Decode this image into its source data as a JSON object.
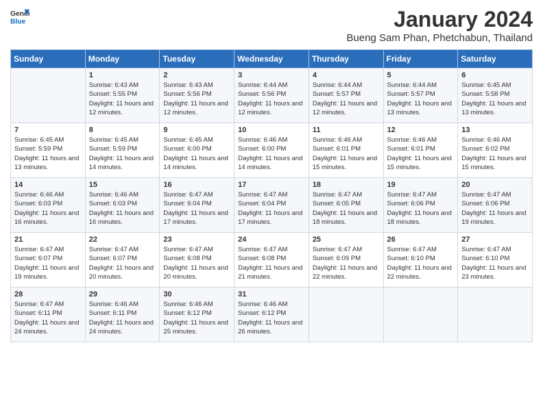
{
  "header": {
    "logo_general": "General",
    "logo_blue": "Blue",
    "month_title": "January 2024",
    "subtitle": "Bueng Sam Phan, Phetchabun, Thailand"
  },
  "days_of_week": [
    "Sunday",
    "Monday",
    "Tuesday",
    "Wednesday",
    "Thursday",
    "Friday",
    "Saturday"
  ],
  "weeks": [
    [
      {
        "day": "",
        "info": ""
      },
      {
        "day": "1",
        "info": "Sunrise: 6:43 AM\nSunset: 5:55 PM\nDaylight: 11 hours and 12 minutes."
      },
      {
        "day": "2",
        "info": "Sunrise: 6:43 AM\nSunset: 5:56 PM\nDaylight: 11 hours and 12 minutes."
      },
      {
        "day": "3",
        "info": "Sunrise: 6:44 AM\nSunset: 5:56 PM\nDaylight: 11 hours and 12 minutes."
      },
      {
        "day": "4",
        "info": "Sunrise: 6:44 AM\nSunset: 5:57 PM\nDaylight: 11 hours and 12 minutes."
      },
      {
        "day": "5",
        "info": "Sunrise: 6:44 AM\nSunset: 5:57 PM\nDaylight: 11 hours and 13 minutes."
      },
      {
        "day": "6",
        "info": "Sunrise: 6:45 AM\nSunset: 5:58 PM\nDaylight: 11 hours and 13 minutes."
      }
    ],
    [
      {
        "day": "7",
        "info": "Sunrise: 6:45 AM\nSunset: 5:59 PM\nDaylight: 11 hours and 13 minutes."
      },
      {
        "day": "8",
        "info": "Sunrise: 6:45 AM\nSunset: 5:59 PM\nDaylight: 11 hours and 14 minutes."
      },
      {
        "day": "9",
        "info": "Sunrise: 6:45 AM\nSunset: 6:00 PM\nDaylight: 11 hours and 14 minutes."
      },
      {
        "day": "10",
        "info": "Sunrise: 6:46 AM\nSunset: 6:00 PM\nDaylight: 11 hours and 14 minutes."
      },
      {
        "day": "11",
        "info": "Sunrise: 6:46 AM\nSunset: 6:01 PM\nDaylight: 11 hours and 15 minutes."
      },
      {
        "day": "12",
        "info": "Sunrise: 6:46 AM\nSunset: 6:01 PM\nDaylight: 11 hours and 15 minutes."
      },
      {
        "day": "13",
        "info": "Sunrise: 6:46 AM\nSunset: 6:02 PM\nDaylight: 11 hours and 15 minutes."
      }
    ],
    [
      {
        "day": "14",
        "info": "Sunrise: 6:46 AM\nSunset: 6:03 PM\nDaylight: 11 hours and 16 minutes."
      },
      {
        "day": "15",
        "info": "Sunrise: 6:46 AM\nSunset: 6:03 PM\nDaylight: 11 hours and 16 minutes."
      },
      {
        "day": "16",
        "info": "Sunrise: 6:47 AM\nSunset: 6:04 PM\nDaylight: 11 hours and 17 minutes."
      },
      {
        "day": "17",
        "info": "Sunrise: 6:47 AM\nSunset: 6:04 PM\nDaylight: 11 hours and 17 minutes."
      },
      {
        "day": "18",
        "info": "Sunrise: 6:47 AM\nSunset: 6:05 PM\nDaylight: 11 hours and 18 minutes."
      },
      {
        "day": "19",
        "info": "Sunrise: 6:47 AM\nSunset: 6:06 PM\nDaylight: 11 hours and 18 minutes."
      },
      {
        "day": "20",
        "info": "Sunrise: 6:47 AM\nSunset: 6:06 PM\nDaylight: 11 hours and 19 minutes."
      }
    ],
    [
      {
        "day": "21",
        "info": "Sunrise: 6:47 AM\nSunset: 6:07 PM\nDaylight: 11 hours and 19 minutes."
      },
      {
        "day": "22",
        "info": "Sunrise: 6:47 AM\nSunset: 6:07 PM\nDaylight: 11 hours and 20 minutes."
      },
      {
        "day": "23",
        "info": "Sunrise: 6:47 AM\nSunset: 6:08 PM\nDaylight: 11 hours and 20 minutes."
      },
      {
        "day": "24",
        "info": "Sunrise: 6:47 AM\nSunset: 6:08 PM\nDaylight: 11 hours and 21 minutes."
      },
      {
        "day": "25",
        "info": "Sunrise: 6:47 AM\nSunset: 6:09 PM\nDaylight: 11 hours and 22 minutes."
      },
      {
        "day": "26",
        "info": "Sunrise: 6:47 AM\nSunset: 6:10 PM\nDaylight: 11 hours and 22 minutes."
      },
      {
        "day": "27",
        "info": "Sunrise: 6:47 AM\nSunset: 6:10 PM\nDaylight: 11 hours and 23 minutes."
      }
    ],
    [
      {
        "day": "28",
        "info": "Sunrise: 6:47 AM\nSunset: 6:11 PM\nDaylight: 11 hours and 24 minutes."
      },
      {
        "day": "29",
        "info": "Sunrise: 6:46 AM\nSunset: 6:11 PM\nDaylight: 11 hours and 24 minutes."
      },
      {
        "day": "30",
        "info": "Sunrise: 6:46 AM\nSunset: 6:12 PM\nDaylight: 11 hours and 25 minutes."
      },
      {
        "day": "31",
        "info": "Sunrise: 6:46 AM\nSunset: 6:12 PM\nDaylight: 11 hours and 26 minutes."
      },
      {
        "day": "",
        "info": ""
      },
      {
        "day": "",
        "info": ""
      },
      {
        "day": "",
        "info": ""
      }
    ]
  ]
}
